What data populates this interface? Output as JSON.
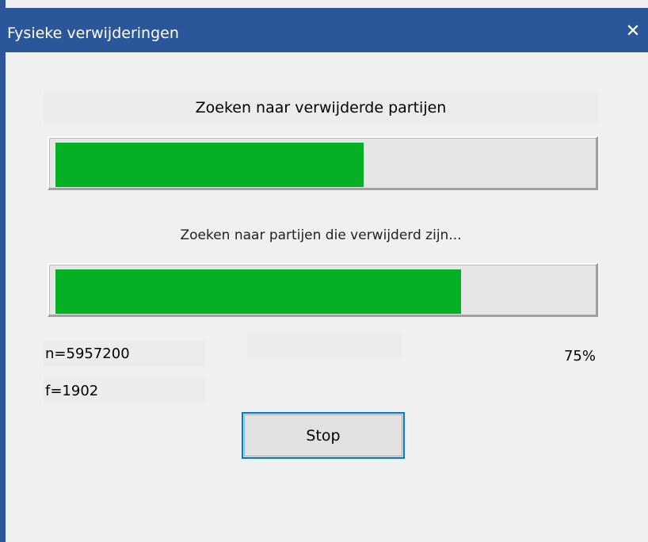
{
  "window": {
    "title": "Fysieke verwijderingen",
    "close_label": "×"
  },
  "main": {
    "heading": "Zoeken naar verwijderde partijen",
    "subtext": "Zoeken naar partijen die verwijderd zijn...",
    "progress_overall_fraction": 0.57,
    "progress_current_fraction": 0.75,
    "n_value": "n=5957200",
    "f_value": "f=1902",
    "percent": "75%",
    "stop_label": "Stop"
  },
  "colors": {
    "titlebar": "#2b579a",
    "progress_fill": "#06b025",
    "progress_track": "#e6e6e6",
    "focus_border": "#0078d7"
  }
}
